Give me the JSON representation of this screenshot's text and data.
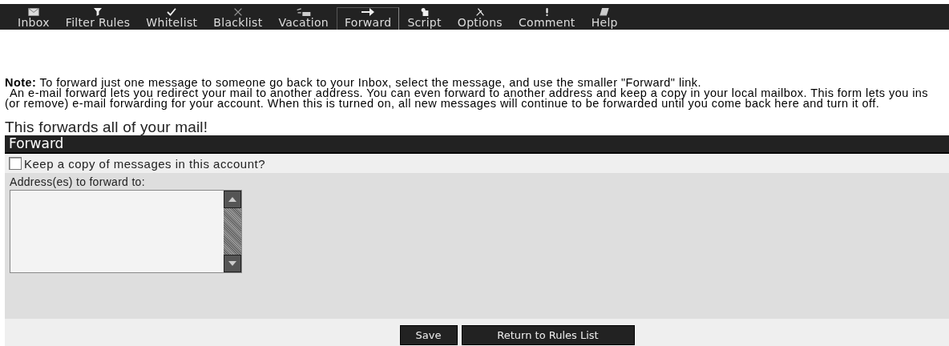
{
  "toolbar": [
    {
      "label": "Inbox",
      "selected": false
    },
    {
      "label": "Filter Rules",
      "selected": false
    },
    {
      "label": "Whitelist",
      "selected": false
    },
    {
      "label": "Blacklist",
      "selected": false
    },
    {
      "label": "Vacation",
      "selected": false
    },
    {
      "label": "Forward",
      "selected": true
    },
    {
      "label": "Script",
      "selected": false
    },
    {
      "label": "Options",
      "selected": false
    },
    {
      "label": "Comment",
      "selected": false
    },
    {
      "label": "Help",
      "selected": false
    }
  ],
  "note": "**Note:** To forward just one message to someone go back to your Inbox, select the message, and use the smaller \"Forward\" link.",
  "description": [
    "An e-mail forward lets you redirect your mail to another address. You can even forward to another address and keep a copy in your local mailbox. This form lets you ins",
    "(or remove) e-mail forwarding for your account. When this is turned on, all new messages will continue to be forwarded until you come back here and turn it off."
  ],
  "heading": "This forwards all of your mail!",
  "panel": {
    "title": "Forward",
    "keep_copy": {
      "label": "Keep a copy of messages in this account?",
      "checked": false
    },
    "address": {
      "label": "Address(es) to forward to:"
    }
  },
  "buttons": [
    "Save",
    "Return to Rules List"
  ]
}
